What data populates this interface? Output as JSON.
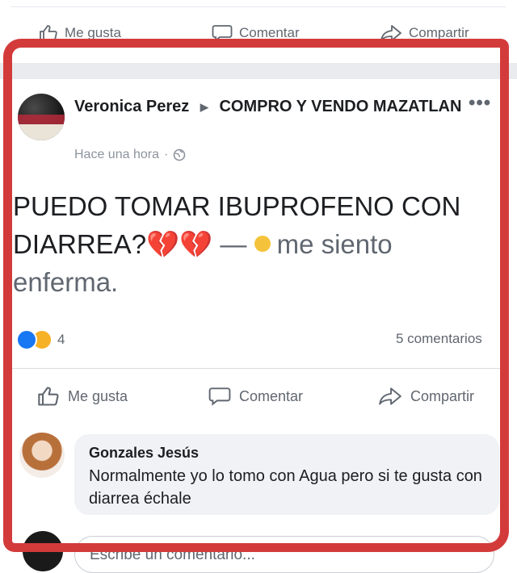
{
  "previous_post": {
    "actions": {
      "like": "Me gusta",
      "comment": "Comentar",
      "share": "Compartir"
    }
  },
  "post": {
    "author": "Veronica Perez",
    "group": "COMPRO Y VENDO MAZATLAN",
    "time": "Hace una hora",
    "audience_icon": "globe-icon",
    "text_main": "PUEDO TOMAR IBUPROFENO CON DIARREA?",
    "text_emoji": "💔💔",
    "text_dash": "—",
    "feeling": "me siento enferma.",
    "reactions": {
      "types": [
        "like",
        "haha"
      ],
      "count": "4"
    },
    "comments_count": "5 comentarios",
    "actions": {
      "like": "Me gusta",
      "comment": "Comentar",
      "share": "Compartir"
    }
  },
  "comment": {
    "author": "Gonzales Jesús",
    "text": "Normalmente yo lo tomo con Agua pero  si te gusta con diarrea échale"
  },
  "write_comment": {
    "placeholder": "Escribe un comentario..."
  },
  "colors": {
    "highlight": "#d33b3b",
    "like_blue": "#1877f2",
    "muted": "#606770"
  }
}
